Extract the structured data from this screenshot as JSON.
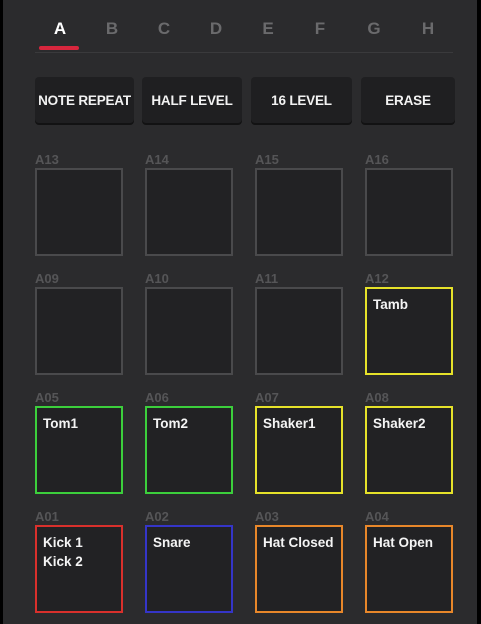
{
  "banks": [
    "A",
    "B",
    "C",
    "D",
    "E",
    "F",
    "G",
    "H"
  ],
  "active_bank": "A",
  "accent_color": "#d7263d",
  "buttons": {
    "note_repeat": "NOTE REPEAT",
    "half_level": "HALF LEVEL",
    "sixteen_level": "16 LEVEL",
    "erase": "ERASE"
  },
  "pads": {
    "a13": {
      "label": "A13",
      "name": "",
      "color": "#4a4a4c"
    },
    "a14": {
      "label": "A14",
      "name": "",
      "color": "#4a4a4c"
    },
    "a15": {
      "label": "A15",
      "name": "",
      "color": "#4a4a4c"
    },
    "a16": {
      "label": "A16",
      "name": "",
      "color": "#4a4a4c"
    },
    "a09": {
      "label": "A09",
      "name": "",
      "color": "#4a4a4c"
    },
    "a10": {
      "label": "A10",
      "name": "",
      "color": "#4a4a4c"
    },
    "a11": {
      "label": "A11",
      "name": "",
      "color": "#4a4a4c"
    },
    "a12": {
      "label": "A12",
      "name": "Tamb",
      "color": "#e6e22a"
    },
    "a05": {
      "label": "A05",
      "name": "Tom1",
      "color": "#3ccf3c"
    },
    "a06": {
      "label": "A06",
      "name": "Tom2",
      "color": "#3ccf3c"
    },
    "a07": {
      "label": "A07",
      "name": "Shaker1",
      "color": "#e6e22a"
    },
    "a08": {
      "label": "A08",
      "name": "Shaker2",
      "color": "#e6e22a"
    },
    "a01": {
      "label": "A01",
      "name": "Kick 1\nKick 2",
      "color": "#d9302c"
    },
    "a02": {
      "label": "A02",
      "name": "Snare",
      "color": "#3535c8"
    },
    "a03": {
      "label": "A03",
      "name": "Hat Closed",
      "color": "#e8872a"
    },
    "a04": {
      "label": "A04",
      "name": "Hat Open",
      "color": "#e8872a"
    }
  }
}
